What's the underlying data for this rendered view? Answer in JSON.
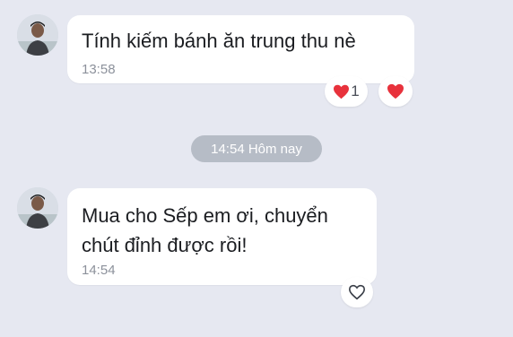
{
  "messages": [
    {
      "text": "Tính kiếm bánh ăn trung thu nè",
      "time": "13:58",
      "reactions": [
        {
          "icon": "heart-icon",
          "count": "1"
        },
        {
          "icon": "heart-icon",
          "count": ""
        }
      ]
    },
    {
      "text_line1": "Mua cho Sếp em ơi, chuyển",
      "text_line2": "chút đỉnh được rồi!",
      "time": "14:54",
      "reactions": [
        {
          "icon": "heart-outline-icon",
          "count": ""
        }
      ]
    }
  ],
  "divider": {
    "label": "14:54 Hôm nay"
  },
  "colors": {
    "background": "#e6e8f1",
    "bubble": "#ffffff",
    "heart": "#e8323c",
    "divider_pill": "#b6bcc6"
  }
}
